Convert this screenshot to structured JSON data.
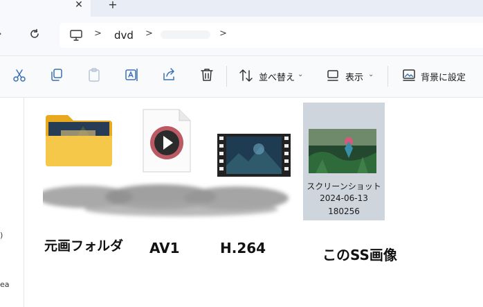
{
  "address": {
    "location": "dvd",
    "path_separator": ">"
  },
  "command_bar": {
    "sort_label": "並べ替え",
    "view_label": "表示",
    "set_background_label": "背景に設定"
  },
  "files": [
    {
      "kind": "folder",
      "name_redacted": true
    },
    {
      "kind": "video-av1",
      "name_redacted": true
    },
    {
      "kind": "video-h264",
      "name_redacted": true
    },
    {
      "kind": "screenshot",
      "name_line1": "スクリーンショット",
      "name_line2": "2024-06-13",
      "name_line3": "180256",
      "selected": true
    }
  ],
  "annotations": {
    "folder": "元画フォルダ",
    "av1": "AV1",
    "h264": "H.264",
    "screenshot": "このSS画像"
  },
  "nav_pane_fragments": [
    ")",
    "ea"
  ],
  "colors": {
    "selection": "#cfd5dd",
    "folder_yellow": "#f4c430",
    "play_accent": "#c0392b"
  }
}
